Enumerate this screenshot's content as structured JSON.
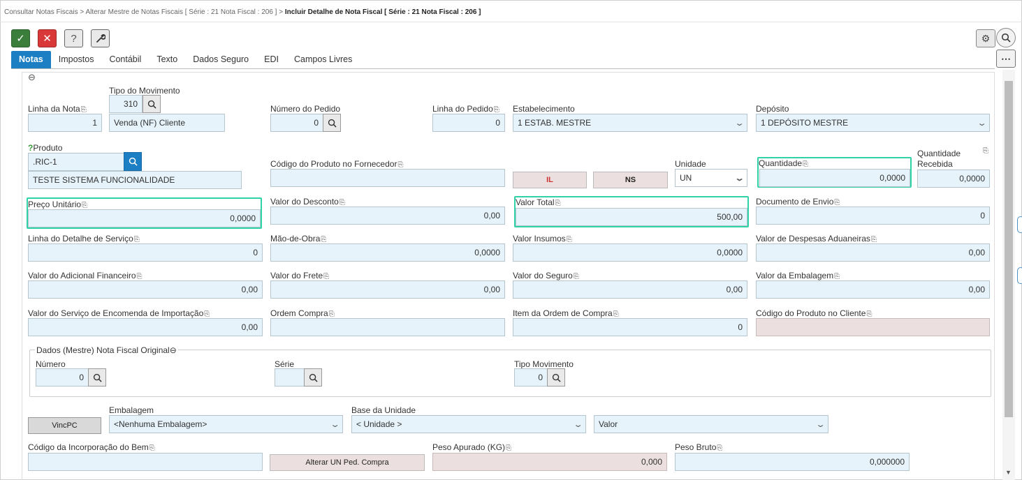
{
  "breadcrumb": {
    "item1": "Consultar Notas Fiscais",
    "sep": ">",
    "item2": "Alterar Mestre de Notas Fiscais [ Série : 21 Nota Fiscal : 206 ]",
    "current": "Incluir Detalhe de Nota Fiscal [ Série : 21 Nota Fiscal : 206 ]"
  },
  "toolbar": {
    "ok_icon": "✓",
    "cancel_icon": "✕",
    "help_icon": "?",
    "tools_icon": "wrench-icon",
    "gear_icon": "⚙",
    "more_icon": "⋯"
  },
  "tabs": [
    "Notas",
    "Impostos",
    "Contábil",
    "Texto",
    "Dados Seguro",
    "EDI",
    "Campos Livres"
  ],
  "collapse_icon": "⊖",
  "copy_icon": "⎘",
  "fields": {
    "linha_nota": {
      "label": "Linha da Nota",
      "value": "1"
    },
    "tipo_movimento": {
      "label": "Tipo do Movimento",
      "code": "310",
      "desc": "Venda (NF) Cliente"
    },
    "numero_pedido": {
      "label": "Número do Pedido",
      "value": "0"
    },
    "linha_pedido": {
      "label": "Linha do Pedido",
      "value": "0"
    },
    "estabelecimento": {
      "label": "Estabelecimento",
      "value": "1 ESTAB. MESTRE"
    },
    "deposito": {
      "label": "Depósito",
      "value": "1 DEPÓSITO MESTRE"
    },
    "produto": {
      "label": "Produto",
      "code": ".RIC-1",
      "desc": "TESTE SISTEMA FUNCIONALIDADE"
    },
    "codigo_fornecedor": {
      "label": "Código do Produto no Fornecedor",
      "value": ""
    },
    "btn_il": "IL",
    "btn_ns": "NS",
    "unidade": {
      "label": "Unidade",
      "value": "UN"
    },
    "quantidade": {
      "label": "Quantidade",
      "value": "0,0000"
    },
    "quantidade_recebida": {
      "label1": "Quantidade",
      "label2": "Recebida",
      "value": "0,0000"
    },
    "preco_unitario": {
      "label": "Preço Unitário",
      "value": "0,0000"
    },
    "valor_desconto": {
      "label": "Valor do Desconto",
      "value": "0,00"
    },
    "valor_total": {
      "label": "Valor Total",
      "value": "500,00"
    },
    "documento_envio": {
      "label": "Documento de Envio",
      "value": "0"
    },
    "linha_detalhe_servico": {
      "label": "Linha do Detalhe de Serviço",
      "value": "0"
    },
    "mao_de_obra": {
      "label": "Mão-de-Obra",
      "value": "0,0000"
    },
    "valor_insumos": {
      "label": "Valor Insumos",
      "value": "0,0000"
    },
    "despesas_aduaneiras": {
      "label": "Valor de Despesas Aduaneiras",
      "value": "0,00"
    },
    "adicional_financeiro": {
      "label": "Valor do Adicional Financeiro",
      "value": "0,00"
    },
    "valor_frete": {
      "label": "Valor do Frete",
      "value": "0,00"
    },
    "valor_seguro": {
      "label": "Valor do Seguro",
      "value": "0,00"
    },
    "valor_embalagem": {
      "label": "Valor da Embalagem",
      "value": "0,00"
    },
    "servico_encomenda": {
      "label": "Valor do Serviço de Encomenda de Importação",
      "value": "0,00"
    },
    "ordem_compra": {
      "label": "Ordem Compra",
      "value": ""
    },
    "item_ordem_compra": {
      "label": "Item da Ordem de Compra",
      "value": "0"
    },
    "codigo_cliente": {
      "label": "Código do Produto no Cliente",
      "value": ""
    }
  },
  "nf_original": {
    "legend": "Dados (Mestre) Nota Fiscal Original",
    "numero": {
      "label": "Número",
      "value": "0"
    },
    "serie": {
      "label": "Série",
      "value": ""
    },
    "tipo_movimento": {
      "label": "Tipo Movimento",
      "value": "0"
    }
  },
  "bottom": {
    "vincpc": "VincPC",
    "embalagem": {
      "label": "Embalagem",
      "value": "<Nenhuma Embalagem>"
    },
    "base_unidade": {
      "label": "Base da Unidade",
      "value": "< Unidade >"
    },
    "valor_select": "Valor",
    "codigo_incorporacao": {
      "label": "Código da Incorporação do Bem",
      "value": ""
    },
    "alterar_un": "Alterar UN Ped. Compra",
    "peso_apurado": {
      "label": "Peso Apurado (KG)",
      "value": "0,000"
    },
    "peso_bruto": {
      "label": "Peso Bruto",
      "value": "0,000000"
    }
  }
}
